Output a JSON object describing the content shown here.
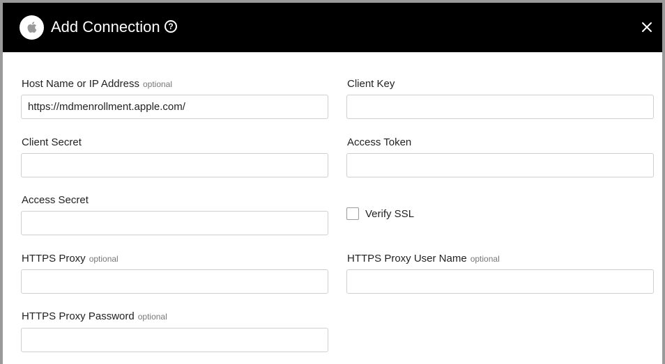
{
  "dialog": {
    "title": "Add Connection",
    "logo_icon": "apple-logo-icon",
    "help_icon": "help-circle-icon",
    "help_glyph": "?",
    "close_icon": "close-icon"
  },
  "fields": {
    "host": {
      "label": "Host Name or IP Address",
      "optional": "optional",
      "value": "https://mdmenrollment.apple.com/"
    },
    "client_key": {
      "label": "Client Key",
      "value": ""
    },
    "client_secret": {
      "label": "Client Secret",
      "value": ""
    },
    "access_token": {
      "label": "Access Token",
      "value": ""
    },
    "access_secret": {
      "label": "Access Secret",
      "value": ""
    },
    "verify_ssl": {
      "label": "Verify SSL",
      "checked": false
    },
    "https_proxy": {
      "label": "HTTPS Proxy",
      "optional": "optional",
      "value": ""
    },
    "https_proxy_user": {
      "label": "HTTPS Proxy User Name",
      "optional": "optional",
      "value": ""
    },
    "https_proxy_password": {
      "label": "HTTPS Proxy Password",
      "optional": "optional",
      "value": ""
    }
  },
  "colors": {
    "header_bg": "#000000",
    "input_border": "#cfcfcf",
    "optional_text": "#777777"
  }
}
